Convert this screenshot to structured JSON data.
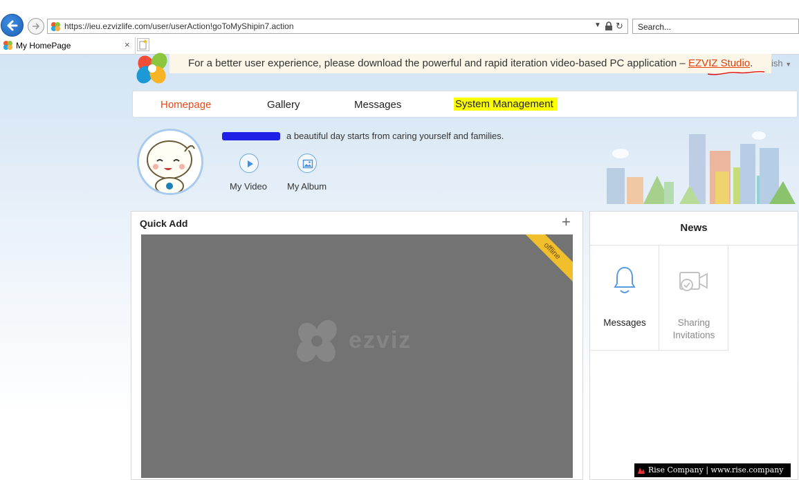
{
  "browser": {
    "url": "https://ieu.ezvizlife.com/user/userAction!goToMyShipin7.action",
    "search_placeholder": "Search...",
    "tab_title": "My HomePage",
    "tab_close": "×"
  },
  "banner": {
    "text": "For a better user experience, please download the powerful and rapid iteration video-based PC application –",
    "link_text": "EZVIZ Studio",
    "suffix": ".",
    "language_fragment": "ish"
  },
  "nav": {
    "items": [
      {
        "label": "Homepage",
        "active": true
      },
      {
        "label": "Gallery",
        "active": false
      },
      {
        "label": "Messages",
        "active": false
      },
      {
        "label": "System Management",
        "active": false
      }
    ]
  },
  "profile": {
    "tagline": "a beautiful day starts from caring yourself and families.",
    "links": [
      {
        "label": "My Video",
        "icon": "play-icon"
      },
      {
        "label": "My Album",
        "icon": "image-icon"
      }
    ]
  },
  "quick_add": {
    "title": "Quick Add",
    "add_symbol": "+",
    "device": {
      "status": "offline",
      "brand": "ezviz"
    }
  },
  "news": {
    "title": "News",
    "items": [
      {
        "label": "Messages",
        "icon": "bell-icon"
      },
      {
        "label": "Sharing Invitations",
        "icon": "camera-share-icon"
      }
    ]
  },
  "watermark": {
    "text": "Rise Company | www.rise.company"
  },
  "colors": {
    "accent": "#e8481a",
    "link": "#e2400d",
    "highlight": "#fbff00",
    "offline_ribbon": "#f1bf2b"
  }
}
